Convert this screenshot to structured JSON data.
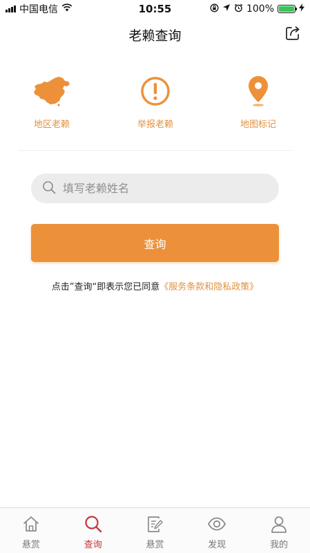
{
  "status_bar": {
    "carrier": "中国电信",
    "time": "10:55",
    "battery": "100%"
  },
  "nav": {
    "title": "老赖查询"
  },
  "features": [
    {
      "label": "地区老赖",
      "icon": "china-map-icon"
    },
    {
      "label": "举报老赖",
      "icon": "alert-circle-icon"
    },
    {
      "label": "地图标记",
      "icon": "map-pin-icon"
    }
  ],
  "search": {
    "placeholder": "填写老赖姓名",
    "value": ""
  },
  "query_button": {
    "label": "查询"
  },
  "agreement": {
    "prefix": "点击”查询“即表示您已同意",
    "link": "《服务条款和隐私政策》"
  },
  "tab_bar": {
    "items": [
      {
        "label": "悬赏",
        "icon": "home-icon",
        "active": false
      },
      {
        "label": "查询",
        "icon": "search-icon",
        "active": true
      },
      {
        "label": "悬赏",
        "icon": "edit-note-icon",
        "active": false
      },
      {
        "label": "发现",
        "icon": "eye-icon",
        "active": false
      },
      {
        "label": "我的",
        "icon": "user-icon",
        "active": false
      }
    ]
  },
  "colors": {
    "accent": "#ec913a",
    "label_orange": "#e0913f",
    "tab_active": "#c5333b",
    "tab_inactive": "#8a8a8a"
  }
}
